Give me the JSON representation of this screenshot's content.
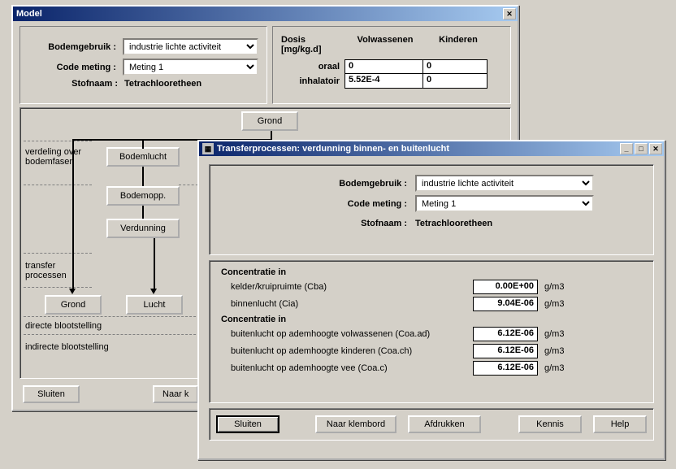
{
  "model_window": {
    "title": "Model",
    "labels": {
      "bodemgebruik": "Bodemgebruik :",
      "code_meting": "Code meting :",
      "stofnaam": "Stofnaam :"
    },
    "values": {
      "bodemgebruik": "industrie lichte activiteit",
      "code_meting": "Meting 1",
      "stofnaam": "Tetrachlooretheen"
    },
    "dosis": {
      "header": "Dosis",
      "unit": "[mg/kg.d]",
      "col_volwassenen": "Volwassenen",
      "col_kinderen": "Kinderen",
      "rows": {
        "oraal": "oraal",
        "inhalatoir": "inhalatoir"
      },
      "data": {
        "oraal_v": "0",
        "oraal_k": "0",
        "inh_v": "5.52E-4",
        "inh_k": "0"
      }
    },
    "nodes": {
      "grond_top": "Grond",
      "bodemlucht": "Bodemlucht",
      "bodemopp": "Bodemopp.",
      "verdunning": "Verdunning",
      "grond_bottom": "Grond",
      "lucht": "Lucht"
    },
    "side_labels": {
      "verdeling": "verdeling over bodemfasen",
      "transfer": "transfer processen",
      "directe": "directe blootstelling",
      "indirecte": "indirecte blootstelling"
    },
    "buttons": {
      "sluiten": "Sluiten",
      "naar_klembord": "Naar k"
    }
  },
  "transfer_window": {
    "title": "Transferprocessen:  verdunning binnen- en buitenlucht",
    "labels": {
      "bodemgebruik": "Bodemgebruik :",
      "code_meting": "Code meting :",
      "stofnaam": "Stofnaam :"
    },
    "values": {
      "bodemgebruik": "industrie lichte activiteit",
      "code_meting": "Meting 1",
      "stofnaam": "Tetrachlooretheen"
    },
    "group1_header": "Concentratie in",
    "group2_header": "Concentratie in",
    "unit": "g/m3",
    "rows": [
      {
        "label": "kelder/kruipruimte  (Cba)",
        "value": "0.00E+00"
      },
      {
        "label": "binnenlucht  (Cia)",
        "value": "9.04E-06"
      }
    ],
    "rows2": [
      {
        "label": "buitenlucht op ademhoogte volwassenen  (Coa.ad)",
        "value": "6.12E-06"
      },
      {
        "label": "buitenlucht op ademhoogte kinderen  (Coa.ch)",
        "value": "6.12E-06"
      },
      {
        "label": "buitenlucht op ademhoogte vee  (Coa.c)",
        "value": "6.12E-06"
      }
    ],
    "buttons": {
      "sluiten": "Sluiten",
      "naar_klembord": "Naar klembord",
      "afdrukken": "Afdrukken",
      "kennis": "Kennis",
      "help": "Help"
    }
  }
}
